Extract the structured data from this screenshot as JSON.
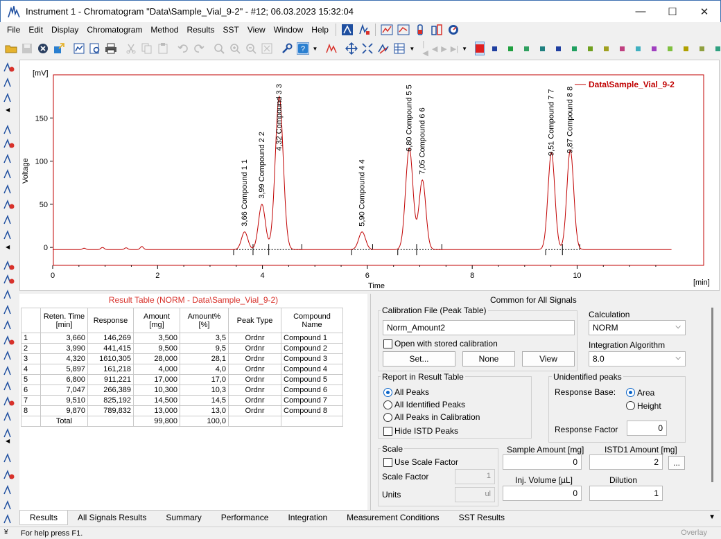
{
  "window": {
    "title": "Instrument 1 - Chromatogram \"Data\\Sample_Vial_9-2\" - #12;   06.03.2023   15:32:04",
    "minimize": "—",
    "maximize": "☐",
    "close": "✕"
  },
  "menu": [
    "File",
    "Edit",
    "Display",
    "Chromatogram",
    "Method",
    "Results",
    "SST",
    "View",
    "Window",
    "Help"
  ],
  "toolbar": {
    "color_palette": [
      "#e02020",
      "#1f3fa0",
      "#20a040",
      "#30a060",
      "#208080",
      "#1f3fa0",
      "#20a060",
      "#70a020",
      "#a0a020",
      "#c04080",
      "#40b0c0",
      "#a040c0",
      "#80c040",
      "#b0a000",
      "#90a040",
      "#30a080",
      "#80a0d0"
    ]
  },
  "chart": {
    "y_unit": "[mV]",
    "y_label": "Voltage",
    "x_label": "Time",
    "x_unit": "[min]",
    "legend": "Data\\Sample_Vial_9-2",
    "line_color": "#c00000"
  },
  "chart_data": {
    "type": "line",
    "title": "",
    "xlabel": "Time",
    "ylabel": "Voltage",
    "xlim": [
      0,
      12.4
    ],
    "ylim": [
      -20,
      200
    ],
    "x_ticks": [
      "0",
      "2",
      "4",
      "6",
      "8",
      "10"
    ],
    "y_ticks": [
      "0",
      "50",
      "100",
      "150"
    ],
    "series": [
      {
        "name": "Data\\Sample_Vial_9-2"
      }
    ],
    "baseline_start": 0.0,
    "baseline_end": 11.8,
    "peaks": [
      {
        "rt": 3.66,
        "height": 18,
        "width": 0.06,
        "label": "3,66 Compound 1   1"
      },
      {
        "rt": 3.99,
        "height": 50,
        "width": 0.065,
        "label": "3,99 Compound 2   2"
      },
      {
        "rt": 4.32,
        "height": 175,
        "width": 0.075,
        "label": "4,32 Compound 3   3"
      },
      {
        "rt": 5.9,
        "height": 18,
        "width": 0.065,
        "label": "5,90 Compound 4   4"
      },
      {
        "rt": 6.8,
        "height": 115,
        "width": 0.07,
        "label": "6,80 Compound 5   5"
      },
      {
        "rt": 7.05,
        "height": 78,
        "width": 0.065,
        "label": "7,05 Compound 6   6"
      },
      {
        "rt": 9.51,
        "height": 110,
        "width": 0.065,
        "label": "9,51 Compound 7   7"
      },
      {
        "rt": 9.87,
        "height": 113,
        "width": 0.065,
        "label": "9,87 Compound 8   8"
      }
    ],
    "noise_bumps": [
      {
        "rt": 0.6,
        "height": 1.5
      },
      {
        "rt": 0.95,
        "height": 2.5
      },
      {
        "rt": 1.4,
        "height": 2
      },
      {
        "rt": 1.7,
        "height": 3.5
      }
    ]
  },
  "result_table": {
    "title": "Result Table (NORM - Data\\Sample_Vial_9-2)",
    "columns": [
      "",
      "Reten. Time [min]",
      "Response",
      "Amount [mg]",
      "Amount% [%]",
      "Peak Type",
      "Compound Name"
    ],
    "rows": [
      [
        "1",
        "3,660",
        "146,269",
        "3,500",
        "3,5",
        "Ordnr",
        "Compound 1"
      ],
      [
        "2",
        "3,990",
        "441,415",
        "9,500",
        "9,5",
        "Ordnr",
        "Compound 2"
      ],
      [
        "3",
        "4,320",
        "1610,305",
        "28,000",
        "28,1",
        "Ordnr",
        "Compound 3"
      ],
      [
        "4",
        "5,897",
        "161,218",
        "4,000",
        "4,0",
        "Ordnr",
        "Compound 4"
      ],
      [
        "5",
        "6,800",
        "911,221",
        "17,000",
        "17,0",
        "Ordnr",
        "Compound 5"
      ],
      [
        "6",
        "7,047",
        "266,389",
        "10,300",
        "10,3",
        "Ordnr",
        "Compound 6"
      ],
      [
        "7",
        "9,510",
        "825,192",
        "14,500",
        "14,5",
        "Ordnr",
        "Compound 7"
      ],
      [
        "8",
        "9,870",
        "789,832",
        "13,000",
        "13,0",
        "Ordnr",
        "Compound 8"
      ]
    ],
    "total": {
      "label": "Total",
      "amount": "99,800",
      "amount_pct": "100,0"
    }
  },
  "common": {
    "header": "Common for All Signals",
    "calib_group": "Calibration File (Peak Table)",
    "calib_file": "Norm_Amount2",
    "open_with_stored": "Open with stored calibration",
    "btn_set": "Set...",
    "btn_none": "None",
    "btn_view": "View",
    "calculation_label": "Calculation",
    "calculation_value": "NORM",
    "integration_label": "Integration Algorithm",
    "integration_value": "8.0",
    "report_group": "Report in Result Table",
    "report_all_peaks": "All Peaks",
    "report_all_identified": "All Identified Peaks",
    "report_all_in_calib": "All Peaks in Calibration",
    "hide_istd": "Hide ISTD Peaks",
    "unidentified_group": "Unidentified peaks",
    "response_base": "Response Base:",
    "area": "Area",
    "height": "Height",
    "response_factor_label": "Response Factor",
    "response_factor_value": "0",
    "scale_group": "Scale",
    "use_scale_factor": "Use Scale Factor",
    "scale_factor_label": "Scale Factor",
    "scale_factor_value": "1",
    "units_label": "Units",
    "units_value": "ul",
    "sample_amount_label": "Sample Amount [mg]",
    "sample_amount_value": "0",
    "istd_amount_label": "ISTD1 Amount [mg]",
    "istd_amount_value": "2",
    "istd_more": "...",
    "inj_volume_label": "Inj. Volume [µL]",
    "inj_volume_value": "0",
    "dilution_label": "Dilution",
    "dilution_value": "1"
  },
  "tabs": [
    "Results",
    "All Signals Results",
    "Summary",
    "Performance",
    "Integration",
    "Measurement Conditions",
    "SST Results"
  ],
  "status": {
    "help": "For help press F1.",
    "overlay": "Overlay"
  }
}
